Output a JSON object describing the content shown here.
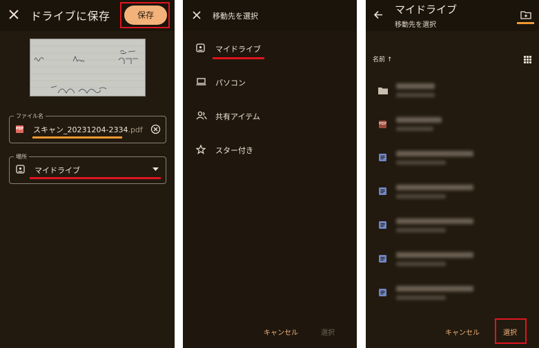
{
  "panel1": {
    "title": "ドライブに保存",
    "save_label": "保存",
    "filename_label": "ファイル名",
    "filename_base": "スキャン_20231204-2334",
    "filename_ext": ".pdf",
    "location_label": "場所",
    "location_value": "マイドライブ",
    "pdf_badge": "PDF",
    "icons": {
      "close": "close-icon",
      "clear": "clear-circle-icon",
      "dropdown": "dropdown-arrow-icon",
      "drive": "drive-icon"
    }
  },
  "panel2": {
    "title": "移動先を選択",
    "items": [
      {
        "label": "マイドライブ",
        "icon": "drive-icon"
      },
      {
        "label": "パソコン",
        "icon": "computer-icon"
      },
      {
        "label": "共有アイテム",
        "icon": "shared-people-icon"
      },
      {
        "label": "スター付き",
        "icon": "star-icon"
      }
    ],
    "cancel_label": "キャンセル",
    "select_label": "選択"
  },
  "panel3": {
    "title": "マイドライブ",
    "subtitle": "移動先を選択",
    "sort_label": "名前 ↑",
    "file_types": [
      "folder",
      "pdf",
      "doc",
      "doc",
      "doc",
      "doc",
      "doc"
    ],
    "pdf_badge": "PDF",
    "cancel_label": "キャンセル",
    "select_label": "選択"
  },
  "colors": {
    "background": "#221a0f",
    "accent_orange": "#f2b27a",
    "underline_orange": "#f29a33",
    "highlight_red": "#e01520",
    "doc_blue": "#6f86c4",
    "pdf_red": "#e06a5e"
  }
}
